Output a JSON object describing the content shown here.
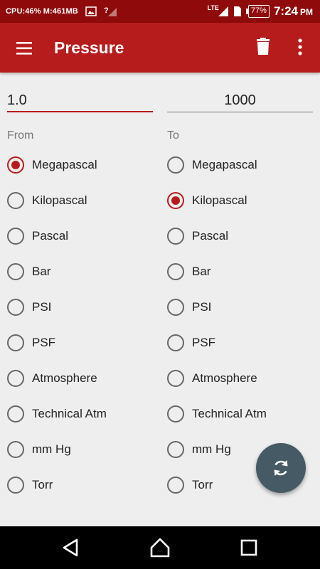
{
  "status_bar": {
    "cpu_mem": "CPU:46% M:461MB",
    "network": "LTE",
    "battery": "77%",
    "time": "7:24",
    "time_suffix": "PM"
  },
  "app_bar": {
    "title": "Pressure",
    "menu_icon": "menu-icon",
    "delete_icon": "delete-icon",
    "more_icon": "more-vert-icon"
  },
  "converter": {
    "from_value": "1.0",
    "to_value": "1000",
    "from_label": "From",
    "to_label": "To"
  },
  "units": [
    "Megapascal",
    "Kilopascal",
    "Pascal",
    "Bar",
    "PSI",
    "PSF",
    "Atmosphere",
    "Technical Atm",
    "mm Hg",
    "Torr"
  ],
  "selected_from": "Megapascal",
  "selected_to": "Kilopascal",
  "fab": {
    "icon": "swap-icon"
  },
  "colors": {
    "primary": "#B71C1C",
    "status_bar": "#8F0A0A",
    "fab": "#455A64",
    "background": "#EEEEEE"
  }
}
